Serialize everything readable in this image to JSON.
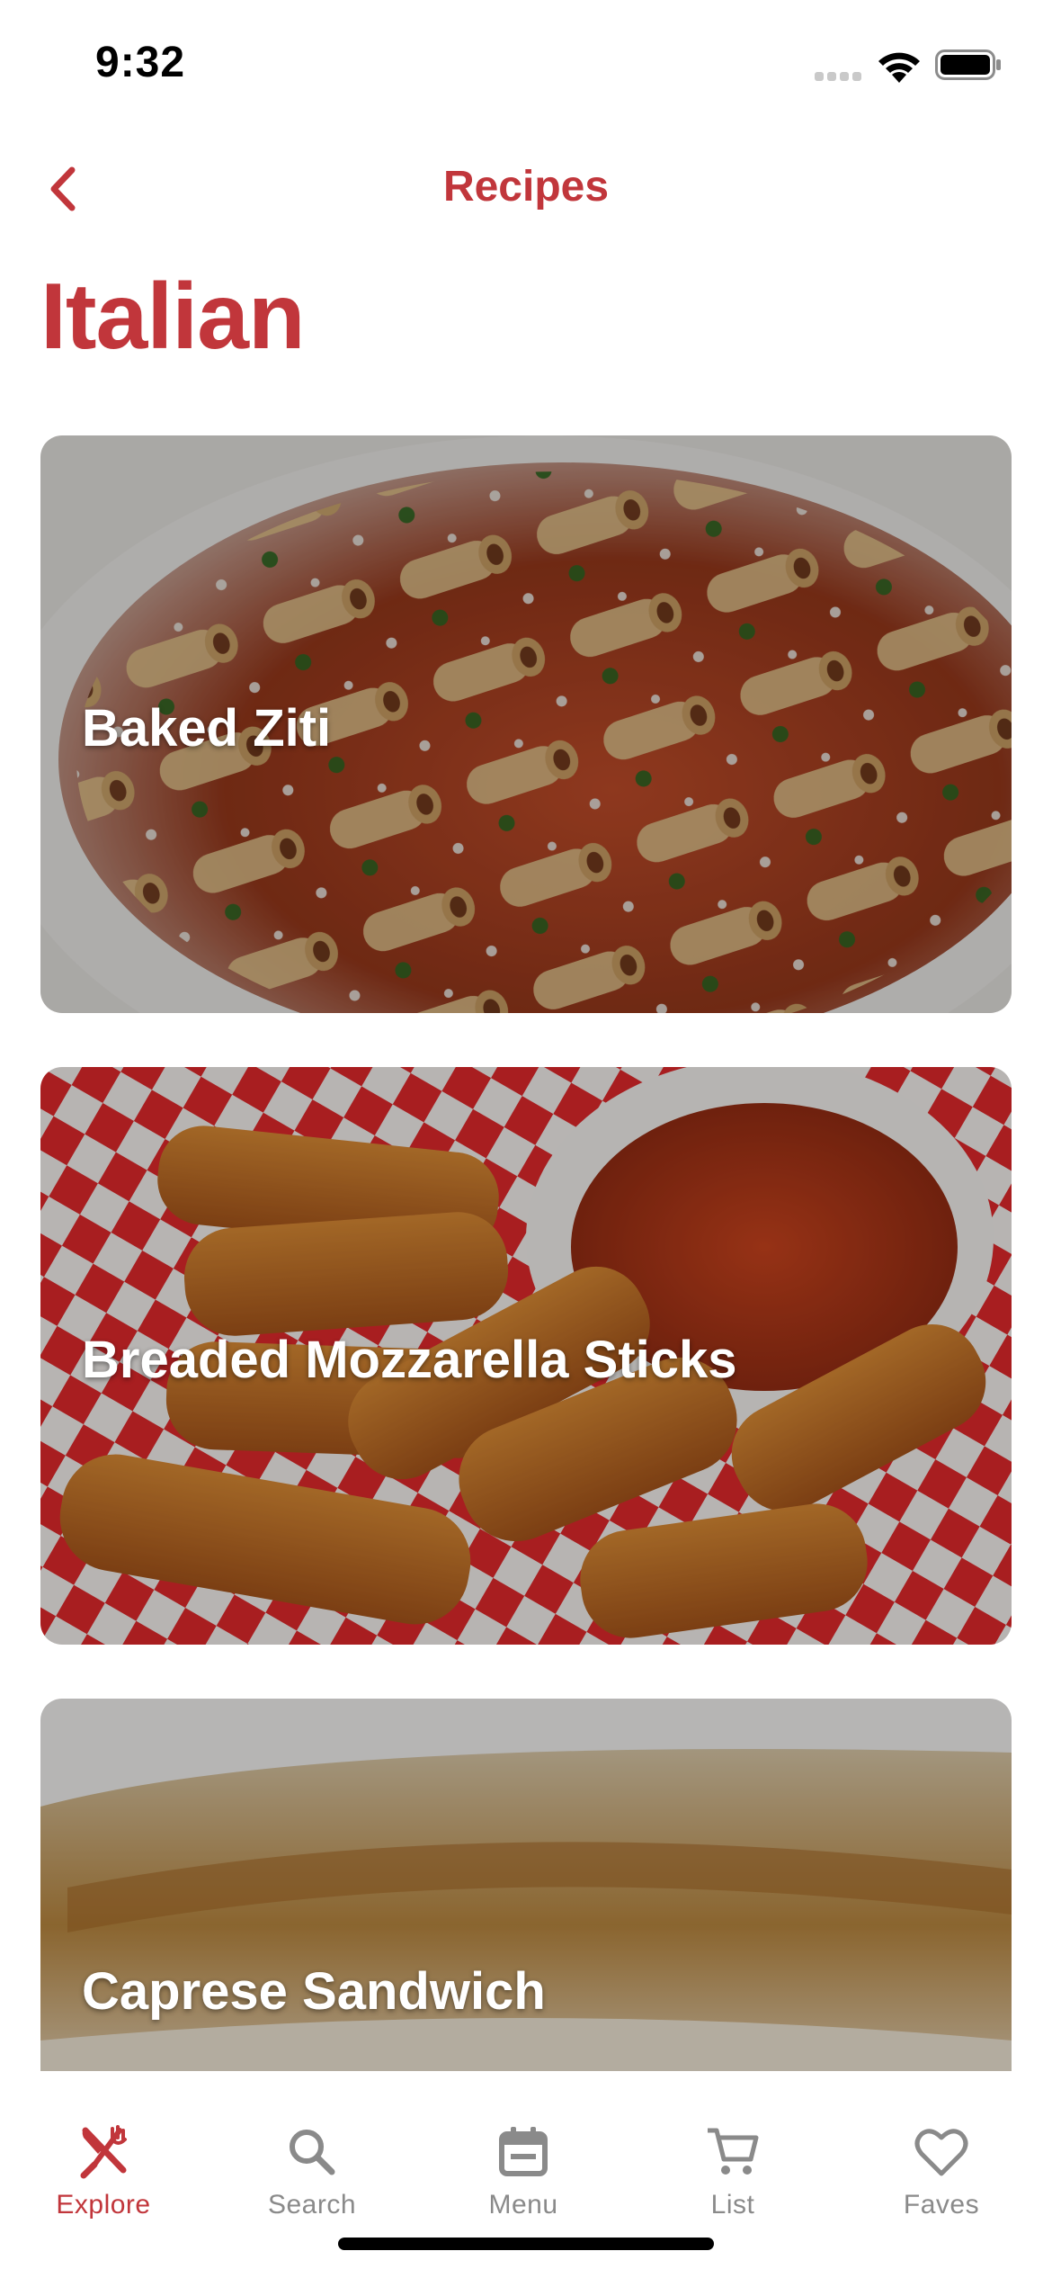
{
  "status_bar": {
    "time": "9:32"
  },
  "nav": {
    "back_icon": "chevron-left-icon",
    "title": "Recipes"
  },
  "page": {
    "title": "Italian"
  },
  "recipes": [
    {
      "title": "Baked Ziti",
      "image": "baked-ziti-photo"
    },
    {
      "title": "Breaded Mozzarella Sticks",
      "image": "mozzarella-sticks-photo"
    },
    {
      "title": "Caprese Sandwich",
      "image": "caprese-sandwich-photo"
    }
  ],
  "tabs": [
    {
      "label": "Explore",
      "icon": "fork-knife-icon",
      "active": true
    },
    {
      "label": "Search",
      "icon": "search-icon",
      "active": false
    },
    {
      "label": "Menu",
      "icon": "calendar-icon",
      "active": false
    },
    {
      "label": "List",
      "icon": "cart-icon",
      "active": false
    },
    {
      "label": "Faves",
      "icon": "heart-icon",
      "active": false
    }
  ],
  "colors": {
    "accent": "#c1363b",
    "inactive": "#8a8a8a",
    "background": "#ffffff"
  }
}
